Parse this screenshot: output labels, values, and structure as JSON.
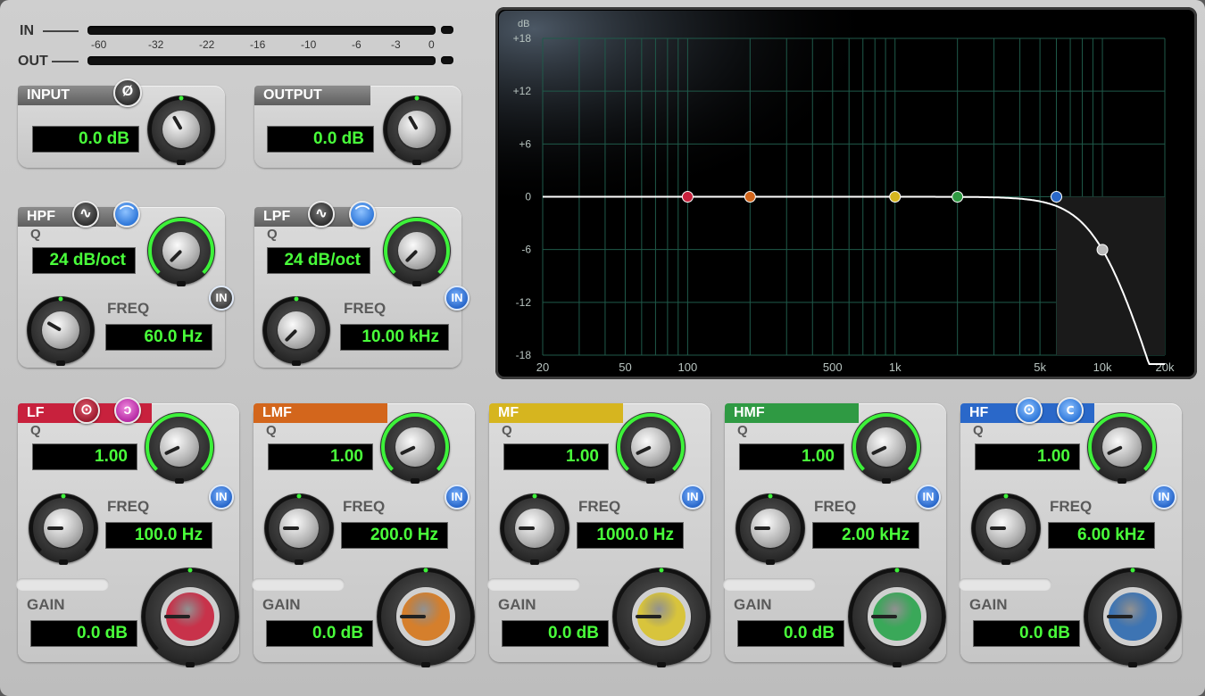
{
  "meters": {
    "in_label": "IN",
    "out_label": "OUT",
    "scale": [
      "-60",
      "-32",
      "-22",
      "-16",
      "-10",
      "-6",
      "-3",
      "0"
    ]
  },
  "input": {
    "title": "INPUT",
    "value": "0.0 dB",
    "phase_icon": "phase-invert-icon"
  },
  "output": {
    "title": "OUTPUT",
    "value": "0.0 dB"
  },
  "hpf": {
    "title": "HPF",
    "q_label": "Q",
    "q_value": "24 dB/oct",
    "freq_label": "FREQ",
    "freq_value": "60.0 Hz",
    "in_label": "IN",
    "in_state": "off"
  },
  "lpf": {
    "title": "LPF",
    "q_label": "Q",
    "q_value": "24 dB/oct",
    "freq_label": "FREQ",
    "freq_value": "10.00 kHz",
    "in_label": "IN",
    "in_state": "on"
  },
  "bands": [
    {
      "title": "LF",
      "color": "#c8213d",
      "knob_color": "#c8324a",
      "q_label": "Q",
      "q_value": "1.00",
      "freq_label": "FREQ",
      "freq_value": "100.0 Hz",
      "gain_label": "GAIN",
      "gain_value": "0.0 dB",
      "in_label": "IN"
    },
    {
      "title": "LMF",
      "color": "#d3661c",
      "knob_color": "#d57f2c",
      "q_label": "Q",
      "q_value": "1.00",
      "freq_label": "FREQ",
      "freq_value": "200.0 Hz",
      "gain_label": "GAIN",
      "gain_value": "0.0 dB",
      "in_label": "IN"
    },
    {
      "title": "MF",
      "color": "#d6b51f",
      "knob_color": "#d8c43c",
      "q_label": "Q",
      "q_value": "1.00",
      "freq_label": "FREQ",
      "freq_value": "1000.0 Hz",
      "gain_label": "GAIN",
      "gain_value": "0.0 dB",
      "in_label": "IN"
    },
    {
      "title": "HMF",
      "color": "#2f9a43",
      "knob_color": "#3aa859",
      "q_label": "Q",
      "q_value": "1.00",
      "freq_label": "FREQ",
      "freq_value": "2.00 kHz",
      "gain_label": "GAIN",
      "gain_value": "0.0 dB",
      "in_label": "IN"
    },
    {
      "title": "HF",
      "color": "#2a68c9",
      "knob_color": "#3d74b3",
      "q_label": "Q",
      "q_value": "1.00",
      "freq_label": "FREQ",
      "freq_value": "6.00 kHz",
      "gain_label": "GAIN",
      "gain_value": "0.0 dB",
      "in_label": "IN"
    }
  ],
  "graph": {
    "y_unit": "dB",
    "y_ticks": [
      "+18",
      "+12",
      "+6",
      "0",
      "-6",
      "-12",
      "-18"
    ],
    "x_ticks": [
      "20",
      "50",
      "100",
      "500",
      "1k",
      "5k",
      "10k",
      "20k"
    ],
    "nodes": [
      {
        "band": "LF",
        "freq_hz": 100,
        "gain_db": 0,
        "color": "#c8213d"
      },
      {
        "band": "LMF",
        "freq_hz": 200,
        "gain_db": 0,
        "color": "#d3661c"
      },
      {
        "band": "MF",
        "freq_hz": 1000,
        "gain_db": 0,
        "color": "#d6b51f"
      },
      {
        "band": "HMF",
        "freq_hz": 2000,
        "gain_db": 0,
        "color": "#2f9a43"
      },
      {
        "band": "HF",
        "freq_hz": 6000,
        "gain_db": 0,
        "color": "#2a68c9"
      },
      {
        "band": "LPF",
        "freq_hz": 10000,
        "gain_db": -3,
        "color": "#bbbbbb"
      }
    ]
  }
}
